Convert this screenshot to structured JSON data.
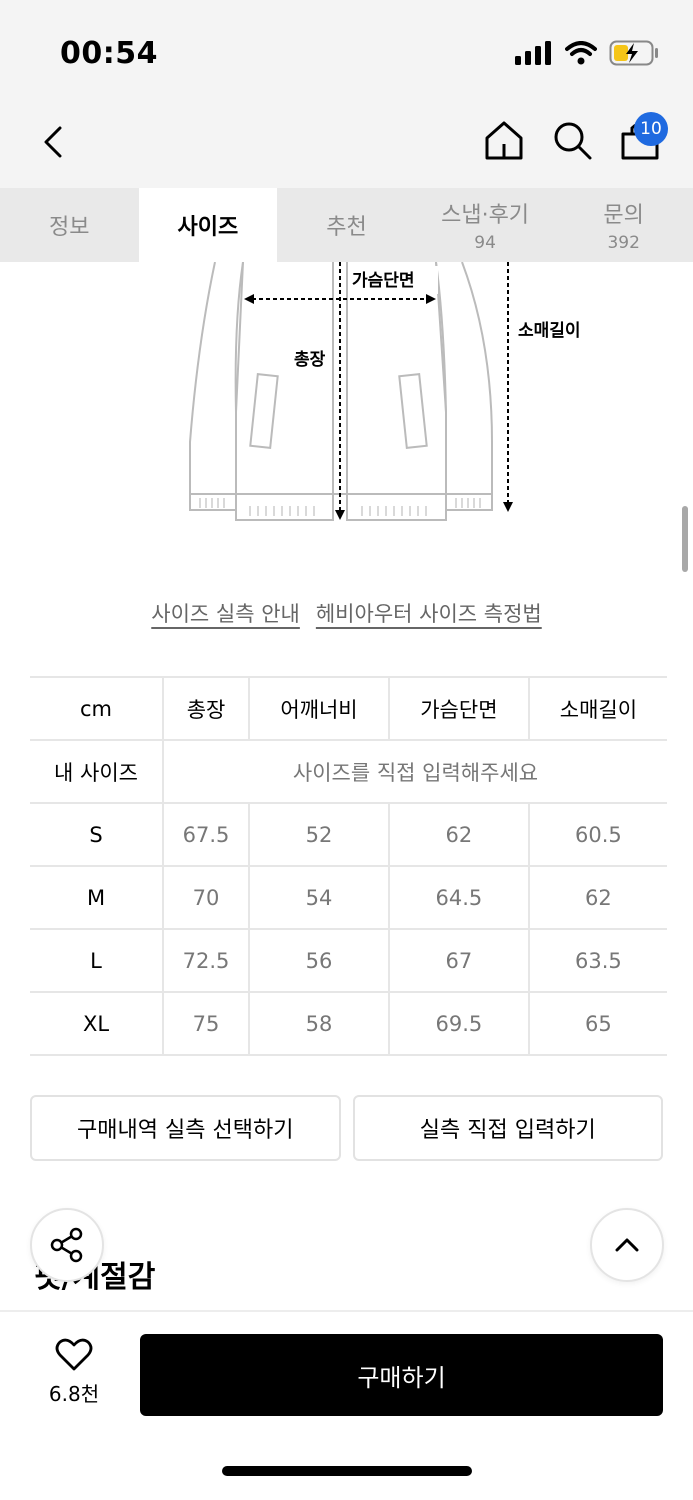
{
  "status": {
    "time": "00:54"
  },
  "nav": {
    "cart_count": "10"
  },
  "tabs": [
    {
      "label": "정보",
      "count": ""
    },
    {
      "label": "사이즈",
      "count": ""
    },
    {
      "label": "추천",
      "count": ""
    },
    {
      "label": "스냅·후기",
      "count": "94"
    },
    {
      "label": "문의",
      "count": "392"
    }
  ],
  "diagram": {
    "chest_label": "가슴단면",
    "length_label": "총장",
    "sleeve_label": "소매길이"
  },
  "links": {
    "size_guide": "사이즈 실측 안내",
    "measure_method": "헤비아우터 사이즈 측정법"
  },
  "table": {
    "headers": [
      "cm",
      "총장",
      "어깨너비",
      "가슴단면",
      "소매길이"
    ],
    "my_size_label": "내 사이즈",
    "my_size_prompt": "사이즈를 직접 입력해주세요",
    "rows": [
      {
        "size": "S",
        "values": [
          "67.5",
          "52",
          "62",
          "60.5"
        ]
      },
      {
        "size": "M",
        "values": [
          "70",
          "54",
          "64.5",
          "62"
        ]
      },
      {
        "size": "L",
        "values": [
          "72.5",
          "56",
          "67",
          "63.5"
        ]
      },
      {
        "size": "XL",
        "values": [
          "75",
          "58",
          "69.5",
          "65"
        ]
      }
    ]
  },
  "buttons": {
    "purchase_history": "구매내역 실측 선택하기",
    "direct_input": "실측 직접 입력하기"
  },
  "section": {
    "title": "핏/계절감"
  },
  "bottom": {
    "like_count": "6.8천",
    "buy_label": "구매하기"
  },
  "colors": {
    "badge": "#1f6ae0",
    "buy_button": "#000000"
  }
}
